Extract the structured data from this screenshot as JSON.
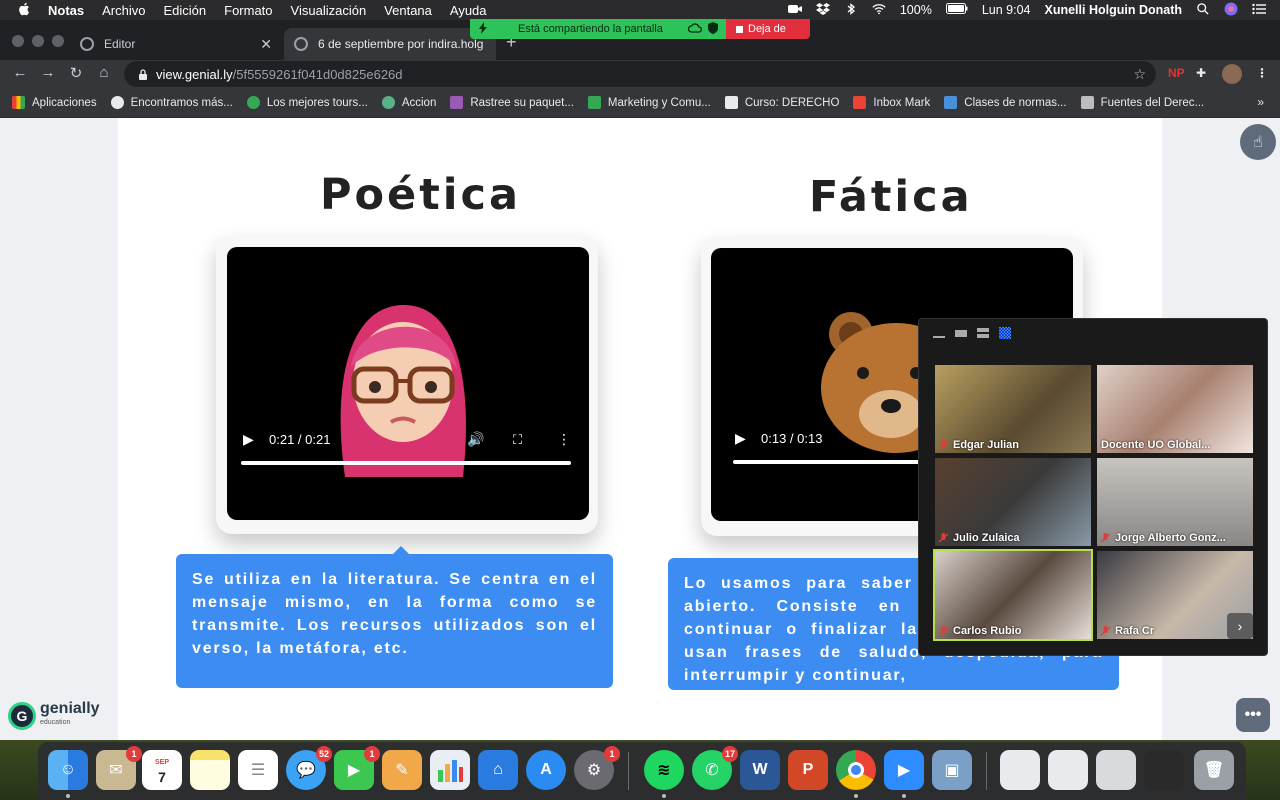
{
  "menubar": {
    "app": "Notas",
    "menus": [
      "Archivo",
      "Edición",
      "Formato",
      "Visualización",
      "Ventana",
      "Ayuda"
    ],
    "battery": "100%",
    "clock": "Lun 9:04",
    "user": "Xunelli Holguin Donath"
  },
  "share_banner": {
    "message": "Está compartiendo la pantalla",
    "stop_label": "Deja de"
  },
  "browser": {
    "tabs": [
      {
        "title": "Editor"
      },
      {
        "title": "6 de septiembre por indira.holg"
      }
    ],
    "url_host": "view.genial.ly",
    "url_path": "/5f5559261f041d0d825e626d",
    "extension_label": "NP",
    "bookmarks": [
      "Aplicaciones",
      "Encontramos más...",
      "Los mejores tours...",
      "Accion",
      "Rastree su paquet...",
      "Marketing y Comu...",
      "Curso: DERECHO",
      "Inbox Mark",
      "Clases de normas...",
      "Fuentes del Derec..."
    ]
  },
  "slide": {
    "left": {
      "title": "Poética",
      "video_time": "0:21 / 0:21",
      "description": "Se utiliza en la literatura. Se centra en el mensaje mismo, en la forma como se transmite. Los recursos utilizados son el verso, la metáfora, etc."
    },
    "right": {
      "title": "Fática",
      "video_time": "0:13 / 0:13",
      "description": "Lo usamos para saber si el canal sigue abierto. Consiste en iniciar, prolongar, continuar o finalizar la comunicación. Se usan frases de saludo, despedida, para interrumpir y continuar,"
    },
    "logo_text": "genially",
    "logo_sub": "education"
  },
  "zoom": {
    "participants": [
      "Edgar Julian",
      "Docente UO Global...",
      "Julio Zulaica",
      "Jorge Alberto Gonz...",
      "Carlos Rubio",
      "Rafa Cr"
    ]
  },
  "dock": {
    "badges": {
      "mail": "1",
      "messages": "52",
      "facetime": "1",
      "prefs": "1",
      "whatsapp": "17"
    },
    "calendar_day": "7",
    "calendar_month": "SEP",
    "word": "W",
    "powerpoint": "P"
  }
}
